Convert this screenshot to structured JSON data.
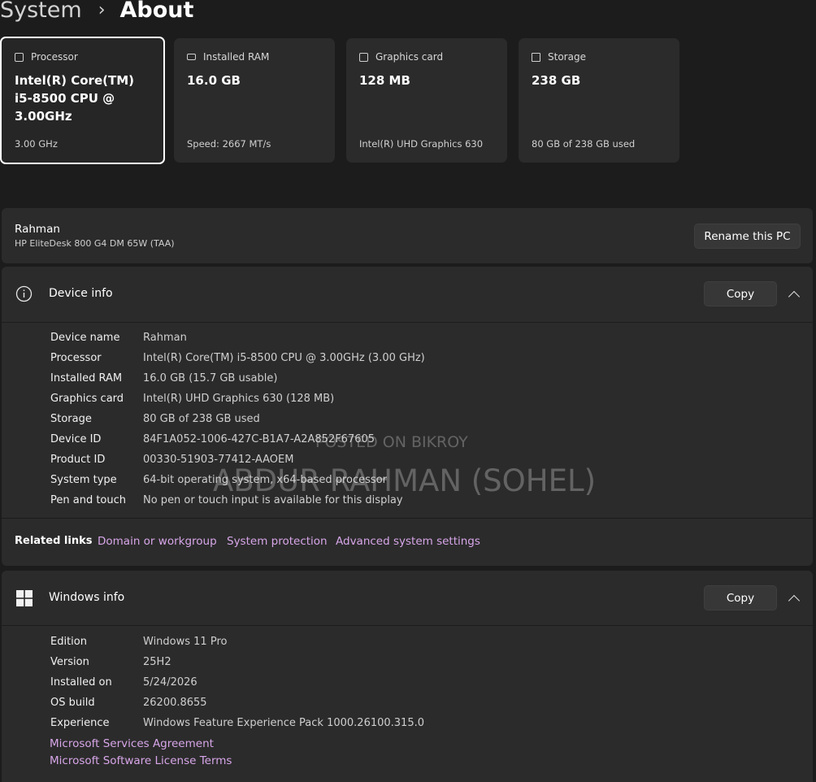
{
  "breadcrumb": {
    "parent": "System",
    "separator": "›",
    "current": "About"
  },
  "spec_cards": [
    {
      "label": "Processor",
      "value": "Intel(R) Core(TM) i5-8500 CPU @ 3.00GHz",
      "detail": "3.00 GHz",
      "icon": "processor-icon"
    },
    {
      "label": "Installed RAM",
      "value": "16.0 GB",
      "detail": "Speed: 2667 MT/s",
      "icon": "ram-icon"
    },
    {
      "label": "Graphics card",
      "value": "128 MB",
      "detail": "Intel(R) UHD Graphics 630",
      "icon": "graphics-card-icon"
    },
    {
      "label": "Storage",
      "value": "238 GB",
      "detail": "80 GB of 238 GB used",
      "icon": "storage-icon"
    }
  ],
  "pc": {
    "name": "Rahman",
    "model": "HP EliteDesk 800 G4 DM 65W (TAA)",
    "rename_label": "Rename this PC"
  },
  "device_info": {
    "title": "Device info",
    "copy_label": "Copy",
    "icon": "info-icon",
    "rows": [
      {
        "key": "Device name",
        "value": "Rahman"
      },
      {
        "key": "Processor",
        "value": "Intel(R) Core(TM) i5-8500 CPU @ 3.00GHz (3.00 GHz)"
      },
      {
        "key": "Installed RAM",
        "value": "16.0 GB (15.7 GB usable)"
      },
      {
        "key": "Graphics card",
        "value": "Intel(R) UHD Graphics 630 (128 MB)"
      },
      {
        "key": "Storage",
        "value": "80 GB of 238 GB used"
      },
      {
        "key": "Device ID",
        "value": "84F1A052-1006-427C-B1A7-A2A852F67605"
      },
      {
        "key": "Product ID",
        "value": "00330-51903-77412-AAOEM"
      },
      {
        "key": "System type",
        "value": "64-bit operating system, x64-based processor"
      },
      {
        "key": "Pen and touch",
        "value": "No pen or touch input is available for this display"
      }
    ]
  },
  "related_links": {
    "label": "Related links",
    "items": [
      "Domain or workgroup",
      "System protection",
      "Advanced system settings"
    ]
  },
  "windows_info": {
    "title": "Windows info",
    "copy_label": "Copy",
    "icon": "windows-logo-icon",
    "rows": [
      {
        "key": "Edition",
        "value": "Windows 11 Pro"
      },
      {
        "key": "Version",
        "value": "25H2"
      },
      {
        "key": "Installed on",
        "value": "5/24/2026"
      },
      {
        "key": "OS build",
        "value": "26200.8655"
      },
      {
        "key": "Experience",
        "value": "Windows Feature Experience Pack 1000.26100.315.0"
      }
    ],
    "links": [
      "Microsoft Services Agreement",
      "Microsoft Software License Terms"
    ]
  },
  "watermark": {
    "line1": "POSTED ON BIKROY",
    "line2": "ABDUR RAHMAN (SOHEL)"
  }
}
